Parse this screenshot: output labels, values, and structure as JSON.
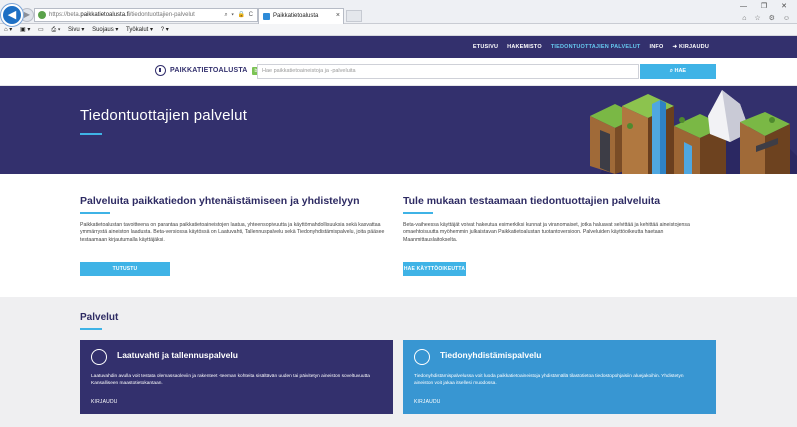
{
  "browser": {
    "url_prefix": "https://beta.",
    "url_domain": "paikkatietoalusta.fi",
    "url_path": "/tiedontuottajien-palvelut",
    "url_tools": "⌕ ▾ 🔒 C",
    "tab_title": "Paikkatietoalusta",
    "tab_close": "×",
    "window_controls": "— ❐ ✕",
    "window_icons": "⌂ ☆ ⚙ ☺"
  },
  "command_bar": {
    "items": [
      "⌂ ▾",
      "▣ ▾",
      "▭",
      "⎙ ▾",
      "Sivu ▾",
      "Suojaus ▾",
      "Työkalut ▾",
      "? ▾"
    ]
  },
  "topnav": {
    "links": [
      "ETUSIVU",
      "HAKEMISTO",
      "TIEDONTUOTTAJIEN PALVELUT",
      "INFO",
      "➜ KIRJAUDU"
    ],
    "active_index": 2
  },
  "header": {
    "logo_text": "PAIKKATIETOALUSTA",
    "beta_badge": "beta",
    "search_placeholder": "Hae paikkatietoaineistoja ja -palveluita",
    "search_button": "⌕ HAE"
  },
  "hero": {
    "title": "Tiedontuottajien palvelut"
  },
  "intro_left": {
    "title": "Palveluita paikkatiedon yhtenäistämiseen ja yhdistelyyn",
    "text": "Paikkatietoalustan tavoitteena on parantaa paikkatietoaineistojen laatua, yhteensopivuutta ja käyttömahdollisuuksia sekä kasvattaa ymmärrystä aineiston laadusta. Beta-versiossa käytössä on Laatuvahti, Tallennuspalvelu sekä Tiedonyhdistämispalvelu, joita pääsee testaamaan kirjautumalla käyttäjäksi.",
    "button": "TUTUSTU PAIKKATIETOALUSTAAN"
  },
  "intro_right": {
    "title": "Tule mukaan testaamaan tiedontuottajien palveluita",
    "text": "Beta-vaiheessa käyttäjät voivat hakeutua esimerkiksi kunnat ja viranomaiset, jotka haluavat selvittää ja kehittää aineistojensa omaehtoisuutta myöhemmin julkaistavan Paikkatietoalustan tuotantoversioon. Palveluiden käyttöoikeutta haetaan Maanmittauslaitokselta.",
    "button": "HAE KÄYTTÖOIKEUTTA"
  },
  "services": {
    "title": "Palvelut",
    "cards": [
      {
        "title": "Laatuvahti ja tallennuspalvelu",
        "text": "Laatuvahdin avulla voit testata olemassaoleviin ja rakenteet -teeman kohteita sisältävän uuden tai päivitetyn aineiston soveltuvuutta Kansalliseen maastotietokantaan.",
        "link": "KIRJAUDU",
        "color": "#33306d"
      },
      {
        "title": "Tiedonyhdistämispalvelu",
        "text": "Tiedonyhdistämispalvelussa voit luoda paikkatietoaineistoja yhdistämällä tilastotietoa tiedostopohjaisiin aluejakoihin. Yhdistetyn aineiston voit jakaa itsellesi muodossa.",
        "link": "KIRJAUDU",
        "color": "#3896d2"
      }
    ]
  },
  "colors": {
    "brand_dark": "#33306d",
    "accent": "#3fb3e6"
  }
}
